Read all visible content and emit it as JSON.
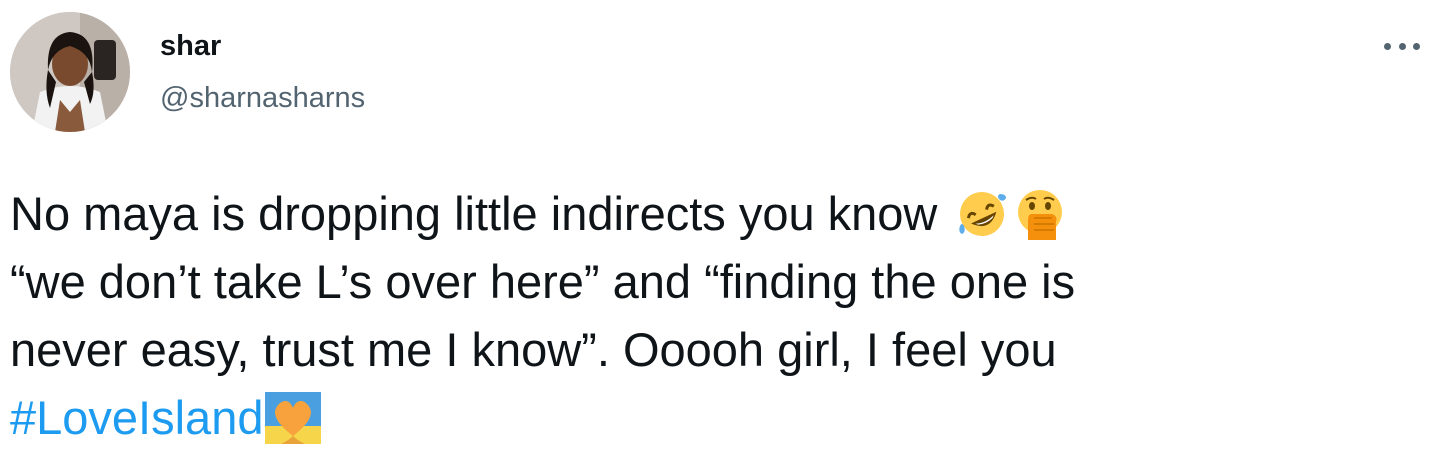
{
  "user": {
    "display_name": "shar",
    "handle": "@sharnasharns"
  },
  "menu": {
    "icon": "more-horizontal-icon"
  },
  "tweet": {
    "line1": "No maya is dropping little indirects you know",
    "line2": "“we don’t take L’s over here” and “finding the one is",
    "line3": "never easy, trust me I know”. Ooooh girl, I feel you",
    "hashtag": "#LoveIsland",
    "emojis": [
      "rolling-on-floor-laughing-emoji",
      "face-with-hand-over-mouth-emoji",
      "love-island-heart-emoji"
    ]
  },
  "colors": {
    "text": "#0f1419",
    "secondary": "#536471",
    "link": "#1d9bf0"
  }
}
